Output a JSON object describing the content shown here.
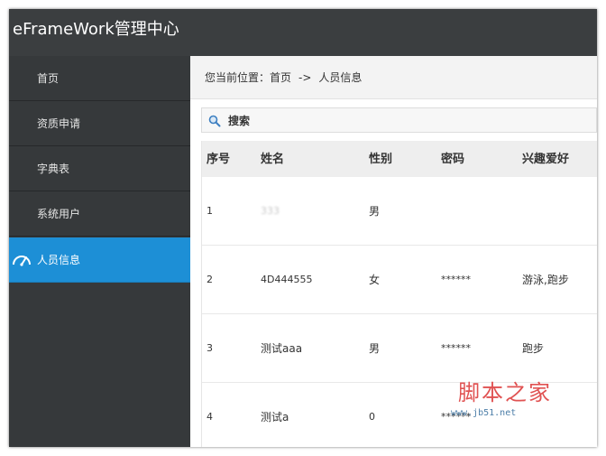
{
  "app": {
    "title": "eFrameWork管理中心"
  },
  "colors": {
    "header_bg": "#3b3e40",
    "sidebar_bg": "#36393b",
    "active_accent": "#1d8fd6"
  },
  "sidebar": {
    "items": [
      {
        "label": "首页",
        "active": false
      },
      {
        "label": "资质申请",
        "active": false
      },
      {
        "label": "字典表",
        "active": false
      },
      {
        "label": "系统用户",
        "active": false
      },
      {
        "label": "人员信息",
        "active": true,
        "icon": "gauge-icon"
      }
    ]
  },
  "breadcrumb": {
    "prefix": "您当前位置：",
    "home": "首页",
    "separator": "->",
    "current": "人员信息"
  },
  "search": {
    "label": "搜索",
    "icon": "search-icon"
  },
  "table": {
    "columns": [
      "序号",
      "姓名",
      "性别",
      "密码",
      "兴趣爱好"
    ],
    "rows": [
      {
        "index": "1",
        "name": "333",
        "gender": "男",
        "password": "",
        "hobby": ""
      },
      {
        "index": "2",
        "name": "4D444555",
        "gender": "女",
        "password": "******",
        "hobby": "游泳,跑步"
      },
      {
        "index": "3",
        "name": "测试aaa",
        "gender": "男",
        "password": "******",
        "hobby": "跑步"
      },
      {
        "index": "4",
        "name": "测试a",
        "gender": "0",
        "password": "******",
        "hobby": ""
      }
    ]
  },
  "watermark": {
    "title": "脚本之家",
    "url": "www.jb51.net"
  }
}
